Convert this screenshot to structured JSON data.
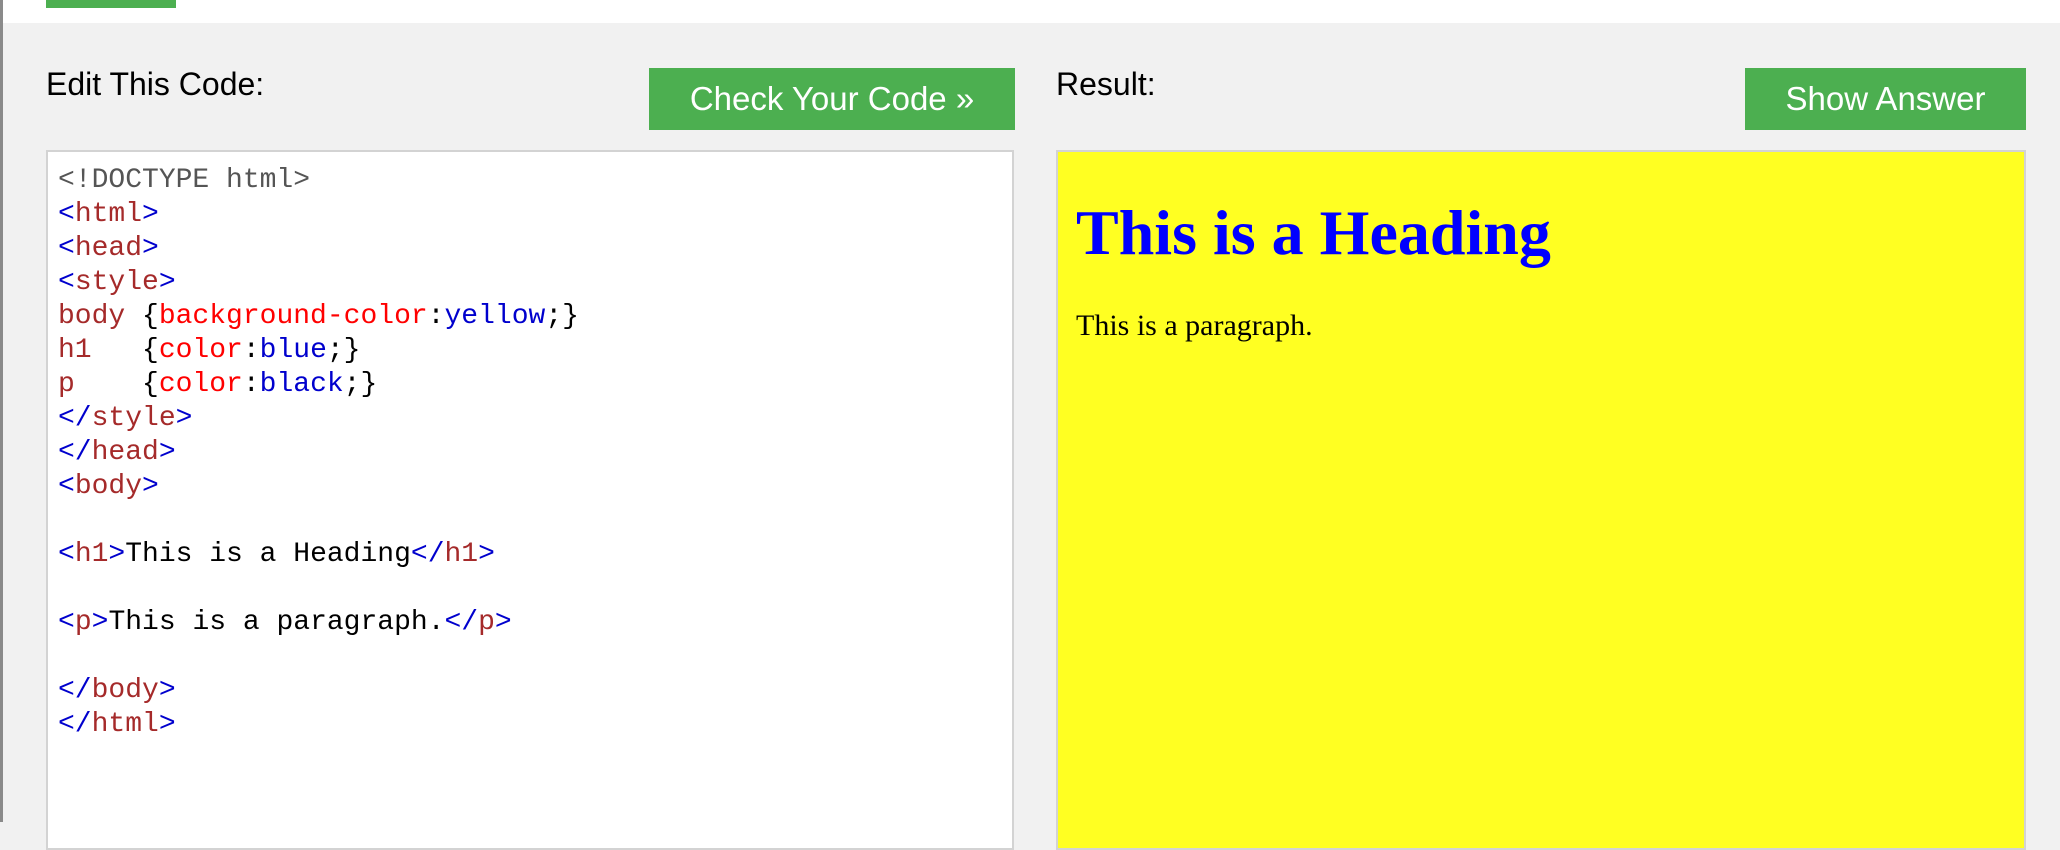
{
  "colors": {
    "accent": "#4caf50",
    "background": "#f1f1f1",
    "result_background": "#ffff22",
    "tag_blue": "#0000cd",
    "tag_brown": "#a52a2a",
    "property_red": "#ff0000"
  },
  "editor_panel": {
    "title": "Edit This Code:",
    "check_button": "Check Your Code »"
  },
  "result_panel": {
    "title": "Result:",
    "answer_button": "Show Answer",
    "heading": "This is a Heading",
    "paragraph": "This is a paragraph."
  },
  "code_lines": [
    [
      {
        "t": "<!DOCTYPE html>",
        "c": "gray"
      }
    ],
    [
      {
        "t": "<",
        "c": "blue"
      },
      {
        "t": "html",
        "c": "brown"
      },
      {
        "t": ">",
        "c": "blue"
      }
    ],
    [
      {
        "t": "<",
        "c": "blue"
      },
      {
        "t": "head",
        "c": "brown"
      },
      {
        "t": ">",
        "c": "blue"
      }
    ],
    [
      {
        "t": "<",
        "c": "blue"
      },
      {
        "t": "style",
        "c": "brown"
      },
      {
        "t": ">",
        "c": "blue"
      }
    ],
    [
      {
        "t": "body ",
        "c": "brown"
      },
      {
        "t": "{",
        "c": "black"
      },
      {
        "t": "background-color",
        "c": "red"
      },
      {
        "t": ":",
        "c": "black"
      },
      {
        "t": "yellow",
        "c": "blue"
      },
      {
        "t": ";}",
        "c": "black"
      }
    ],
    [
      {
        "t": "h1   ",
        "c": "brown"
      },
      {
        "t": "{",
        "c": "black"
      },
      {
        "t": "color",
        "c": "red"
      },
      {
        "t": ":",
        "c": "black"
      },
      {
        "t": "blue",
        "c": "blue"
      },
      {
        "t": ";}",
        "c": "black"
      }
    ],
    [
      {
        "t": "p    ",
        "c": "brown"
      },
      {
        "t": "{",
        "c": "black"
      },
      {
        "t": "color",
        "c": "red"
      },
      {
        "t": ":",
        "c": "black"
      },
      {
        "t": "black",
        "c": "blue"
      },
      {
        "t": ";}",
        "c": "black"
      }
    ],
    [
      {
        "t": "</",
        "c": "blue"
      },
      {
        "t": "style",
        "c": "brown"
      },
      {
        "t": ">",
        "c": "blue"
      }
    ],
    [
      {
        "t": "</",
        "c": "blue"
      },
      {
        "t": "head",
        "c": "brown"
      },
      {
        "t": ">",
        "c": "blue"
      }
    ],
    [
      {
        "t": "<",
        "c": "blue"
      },
      {
        "t": "body",
        "c": "brown"
      },
      {
        "t": ">",
        "c": "blue"
      }
    ],
    [],
    [
      {
        "t": "<",
        "c": "blue"
      },
      {
        "t": "h1",
        "c": "brown"
      },
      {
        "t": ">",
        "c": "blue"
      },
      {
        "t": "This is a Heading",
        "c": "black"
      },
      {
        "t": "</",
        "c": "blue"
      },
      {
        "t": "h1",
        "c": "brown"
      },
      {
        "t": ">",
        "c": "blue"
      }
    ],
    [],
    [
      {
        "t": "<",
        "c": "blue"
      },
      {
        "t": "p",
        "c": "brown"
      },
      {
        "t": ">",
        "c": "blue"
      },
      {
        "t": "This is a paragraph.",
        "c": "black"
      },
      {
        "t": "</",
        "c": "blue"
      },
      {
        "t": "p",
        "c": "brown"
      },
      {
        "t": ">",
        "c": "blue"
      }
    ],
    [],
    [
      {
        "t": "</",
        "c": "blue"
      },
      {
        "t": "body",
        "c": "brown"
      },
      {
        "t": ">",
        "c": "blue"
      }
    ],
    [
      {
        "t": "</",
        "c": "blue"
      },
      {
        "t": "html",
        "c": "brown"
      },
      {
        "t": ">",
        "c": "blue"
      }
    ]
  ]
}
